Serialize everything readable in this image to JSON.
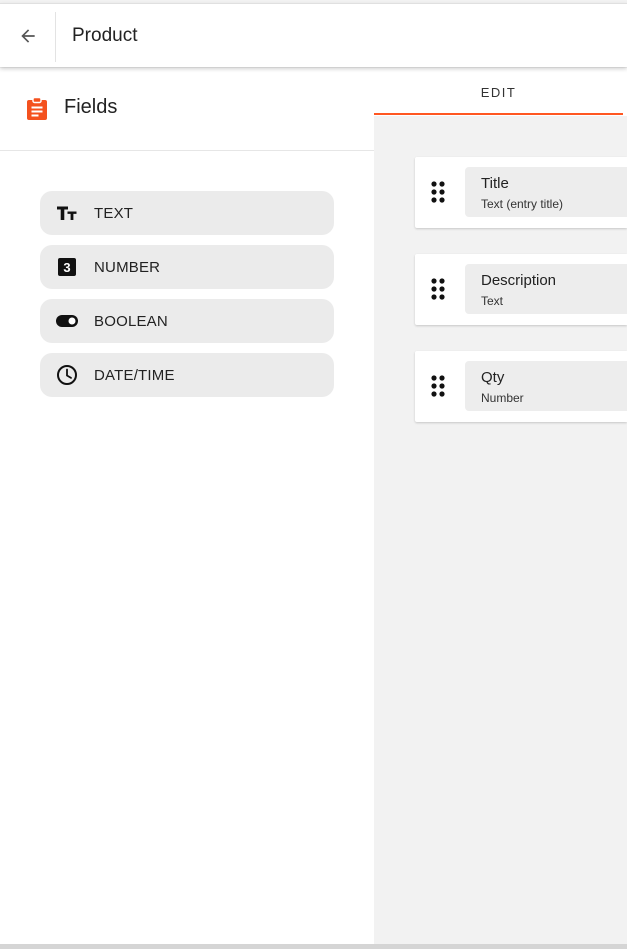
{
  "header": {
    "back_icon": "arrow-left-icon",
    "title": "Product"
  },
  "fields_panel": {
    "icon": "clipboard-icon",
    "icon_color": "#f4511e",
    "title": "Fields",
    "types": [
      {
        "label": "TEXT",
        "icon": "text-fields-icon"
      },
      {
        "label": "NUMBER",
        "icon": "number-three-box-icon"
      },
      {
        "label": "BOOLEAN",
        "icon": "toggle-icon"
      },
      {
        "label": "DATE/TIME",
        "icon": "clock-icon"
      }
    ]
  },
  "editor": {
    "tab_label": "EDIT",
    "accent_color": "#ff5722",
    "fields": [
      {
        "name": "Title",
        "type": "Text (entry title)"
      },
      {
        "name": "Description",
        "type": "Text"
      },
      {
        "name": "Qty",
        "type": "Number"
      }
    ]
  }
}
